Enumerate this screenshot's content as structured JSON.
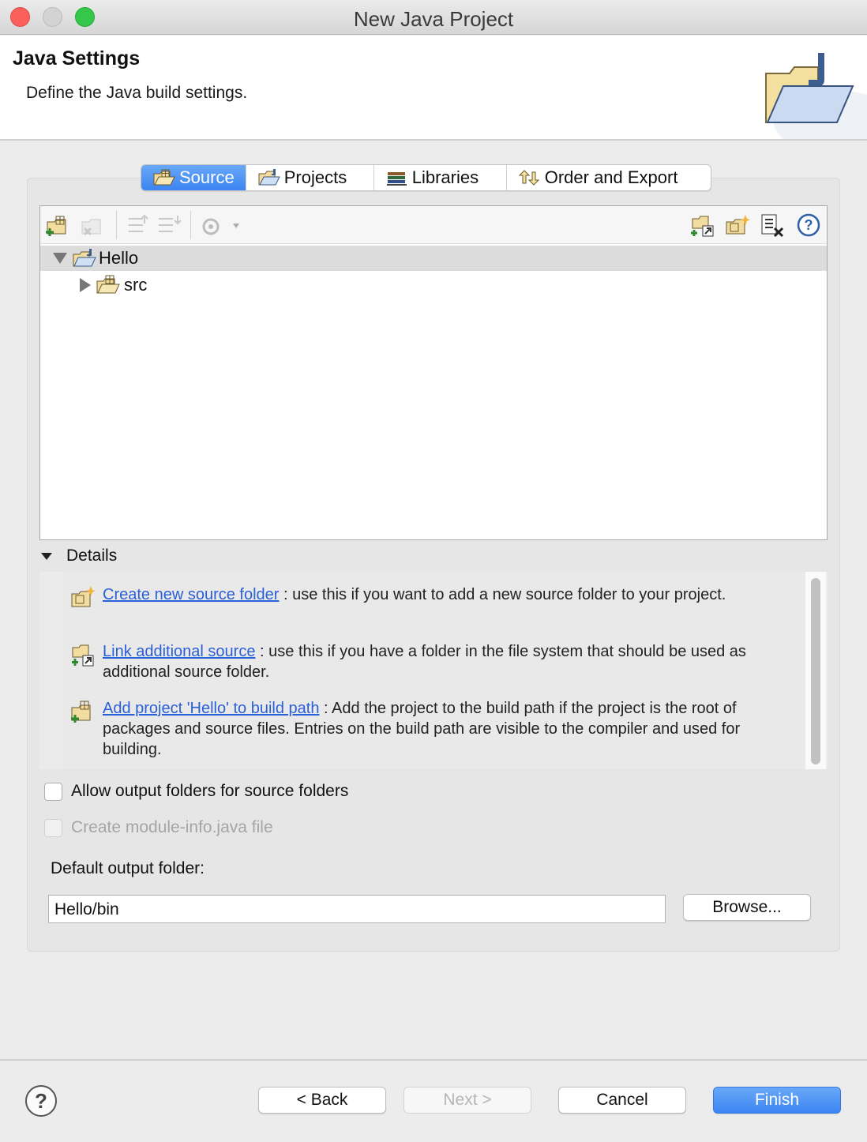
{
  "window": {
    "title": "New Java Project"
  },
  "header": {
    "title": "Java Settings",
    "description": "Define the Java build settings."
  },
  "tabs": [
    {
      "label": "Source",
      "icon": "source-folder-icon",
      "active": true
    },
    {
      "label": "Projects",
      "icon": "projects-icon",
      "active": false
    },
    {
      "label": "Libraries",
      "icon": "libraries-icon",
      "active": false
    },
    {
      "label": "Order and Export",
      "icon": "order-export-icon",
      "active": false
    }
  ],
  "tree": {
    "items": [
      {
        "label": "Hello",
        "expanded": true,
        "icon": "java-project-icon"
      },
      {
        "label": "src",
        "expanded": false,
        "icon": "package-folder-icon"
      }
    ]
  },
  "details": {
    "title": "Details",
    "items": [
      {
        "link": "Create new source folder",
        "text": " : use this if you want to add a new source folder to your project."
      },
      {
        "link": "Link additional source",
        "text": " : use this if you have a folder in the file system that should be used as additional source folder."
      },
      {
        "link": "Add project 'Hello' to build path",
        "text": " : Add the project to the build path if the project is the root of packages and source files. Entries on the build path are visible to the compiler and used for building."
      }
    ]
  },
  "options": {
    "allow_output_folders": "Allow output folders for source folders",
    "create_module_info": "Create module-info.java file"
  },
  "output": {
    "label": "Default output folder:",
    "value": "Hello/bin",
    "browse": "Browse..."
  },
  "footer": {
    "help": "?",
    "back": "< Back",
    "next": "Next >",
    "cancel": "Cancel",
    "finish": "Finish"
  },
  "colors": {
    "accent": "#3c85f2",
    "link": "#2a5fd8"
  }
}
